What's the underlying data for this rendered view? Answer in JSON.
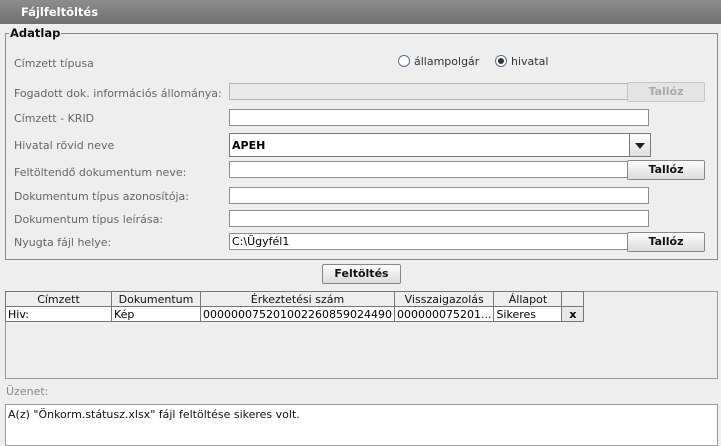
{
  "window": {
    "title": "Fájlfeltöltés"
  },
  "form": {
    "legend": "Adatlap",
    "recipient_type": {
      "label": "Címzett típusa",
      "options": [
        "állampolgár",
        "hivatal"
      ],
      "selected": "hivatal"
    },
    "received_info_file": {
      "label": "Fogadott dok. információs állománya:",
      "value": "",
      "browse": "Tallóz"
    },
    "recipient_krid": {
      "label": "Címzett - KRID",
      "value": ""
    },
    "office_short_name": {
      "label": "Hivatal rövid neve",
      "value": "APEH"
    },
    "upload_doc_name": {
      "label": "Feltöltendő dokumentum neve:",
      "value": "",
      "browse": "Tallóz"
    },
    "doc_type_id": {
      "label": "Dokumentum típus azonosítója:",
      "value": ""
    },
    "doc_type_desc": {
      "label": "Dokumentum típus leírása:",
      "value": ""
    },
    "receipt_path": {
      "label": "Nyugta fájl helye:",
      "value": "C:\\Ügyfél1",
      "browse": "Tallóz"
    }
  },
  "upload_button": "Feltöltés",
  "table": {
    "columns": [
      "Címzett",
      "Dokumentum",
      "Érkeztetési szám",
      "Visszaigazolás",
      "Állapot",
      ""
    ],
    "rows": [
      {
        "recipient": "Hiv:",
        "document": "Kép",
        "reg_number": "00000007520100226085902449​0",
        "confirmation": "000000075201...",
        "status": "Sikeres",
        "action": "x"
      }
    ]
  },
  "message": {
    "label": "Üzenet:",
    "text": "A(z) \"Önkorm.státusz.xlsx\" fájl feltöltése sikeres volt."
  }
}
